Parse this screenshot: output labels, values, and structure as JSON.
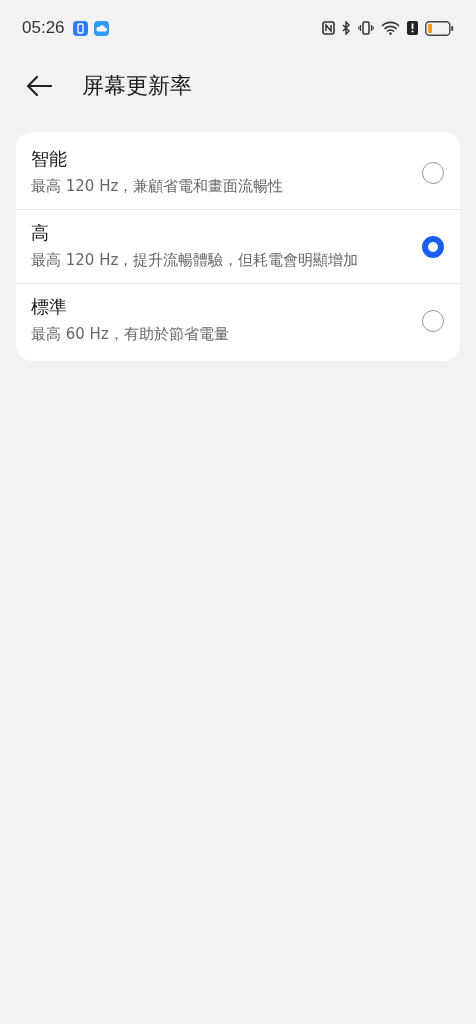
{
  "status_bar": {
    "time": "05:26"
  },
  "header": {
    "title": "屏幕更新率"
  },
  "options": [
    {
      "title": "智能",
      "description": "最高 120 Hz，兼顧省電和畫面流暢性",
      "selected": false
    },
    {
      "title": "高",
      "description": "最高 120 Hz，提升流暢體驗，但耗電會明顯增加",
      "selected": true
    },
    {
      "title": "標準",
      "description": "最高 60 Hz，有助於節省電量",
      "selected": false
    }
  ]
}
